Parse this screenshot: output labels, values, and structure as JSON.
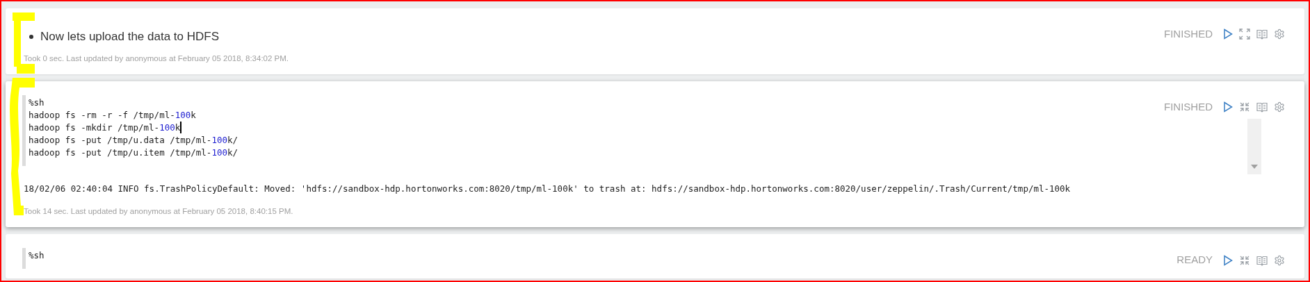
{
  "paragraphs": [
    {
      "kind": "markdown",
      "focused": false,
      "bullets": [
        "Now lets upload the data to HDFS"
      ],
      "status": "FINISHED",
      "full_width": false,
      "footer": "Took 0 sec. Last updated by anonymous at February 05 2018, 8:34:02 PM."
    },
    {
      "kind": "code",
      "focused": true,
      "code_lines": [
        {
          "cursor": false,
          "segments": [
            {
              "kind": "text",
              "text": "%sh"
            }
          ]
        },
        {
          "cursor": false,
          "segments": [
            {
              "kind": "text",
              "text": "hadoop fs -rm -r -f /tmp/ml-"
            },
            {
              "kind": "number",
              "text": "100"
            },
            {
              "kind": "text",
              "text": "k"
            }
          ]
        },
        {
          "cursor": true,
          "segments": [
            {
              "kind": "text",
              "text": "hadoop fs -mkdir /tmp/ml-"
            },
            {
              "kind": "number",
              "text": "100"
            },
            {
              "kind": "text",
              "text": "k"
            }
          ]
        },
        {
          "cursor": false,
          "segments": [
            {
              "kind": "text",
              "text": "hadoop fs -put /tmp/u.data /tmp/ml-"
            },
            {
              "kind": "number",
              "text": "100"
            },
            {
              "kind": "text",
              "text": "k/"
            }
          ]
        },
        {
          "cursor": false,
          "segments": [
            {
              "kind": "text",
              "text": "hadoop fs -put /tmp/u.item /tmp/ml-"
            },
            {
              "kind": "number",
              "text": "100"
            },
            {
              "kind": "text",
              "text": "k/"
            }
          ]
        }
      ],
      "scrollbar": true,
      "output": "18/02/06 02:40:04 INFO fs.TrashPolicyDefault: Moved: 'hdfs://sandbox-hdp.hortonworks.com:8020/tmp/ml-100k' to trash at: hdfs://sandbox-hdp.hortonworks.com:8020/user/zeppelin/.Trash/Current/tmp/ml-100k",
      "status": "FINISHED",
      "full_width": true,
      "footer": "Took 14 sec. Last updated by anonymous at February 05 2018, 8:40:15 PM."
    },
    {
      "kind": "code",
      "focused": false,
      "code_lines": [
        {
          "cursor": false,
          "segments": [
            {
              "kind": "text",
              "text": "%sh"
            }
          ]
        }
      ],
      "status": "READY",
      "full_width": true
    }
  ]
}
